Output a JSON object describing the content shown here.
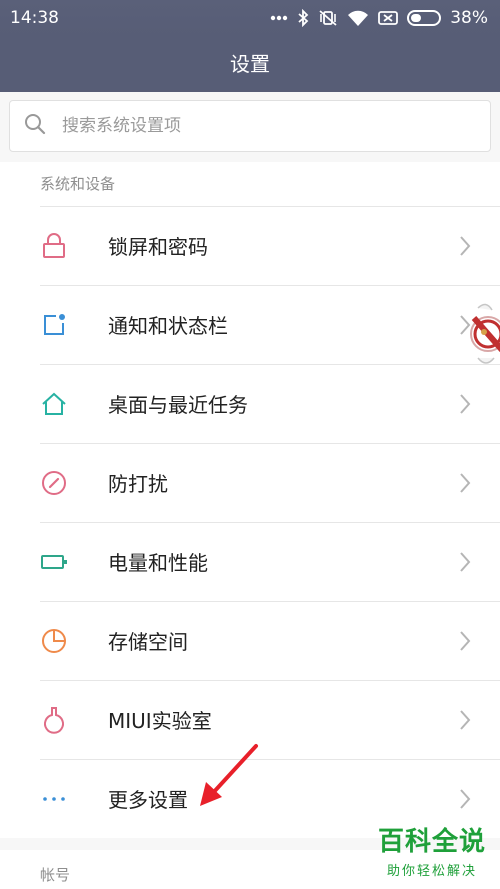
{
  "status_bar": {
    "time": "14:38",
    "battery_percent": "38%",
    "battery_level": 0.38,
    "icons": [
      "more-dots-icon",
      "bluetooth-icon",
      "vibrate-off-icon",
      "wifi-icon",
      "sim-none-icon",
      "battery-icon"
    ]
  },
  "header": {
    "title": "设置"
  },
  "search": {
    "placeholder": "搜索系统设置项"
  },
  "section_system": {
    "title": "系统和设备",
    "items": [
      {
        "label": "锁屏和密码",
        "icon": "lock-icon",
        "color": "#e06c86"
      },
      {
        "label": "通知和状态栏",
        "icon": "notification-icon",
        "color": "#3a8fd6"
      },
      {
        "label": "桌面与最近任务",
        "icon": "home-icon",
        "color": "#27b2a3"
      },
      {
        "label": "防打扰",
        "icon": "do-not-disturb-icon",
        "color": "#e06c86"
      },
      {
        "label": "电量和性能",
        "icon": "battery-performance-icon",
        "color": "#2ea68a"
      },
      {
        "label": "存储空间",
        "icon": "storage-icon",
        "color": "#ef8a4a"
      },
      {
        "label": "MIUI实验室",
        "icon": "lab-flask-icon",
        "color": "#e06c86"
      },
      {
        "label": "更多设置",
        "icon": "more-dots-icon",
        "color": "#3a8fd6"
      }
    ]
  },
  "section_account": {
    "title": "帐号"
  },
  "watermark": {
    "title": "百科全说",
    "subtitle": "助你轻松解决"
  },
  "colors": {
    "header_bg": "#575d76",
    "annotation_arrow": "#e8202a"
  }
}
